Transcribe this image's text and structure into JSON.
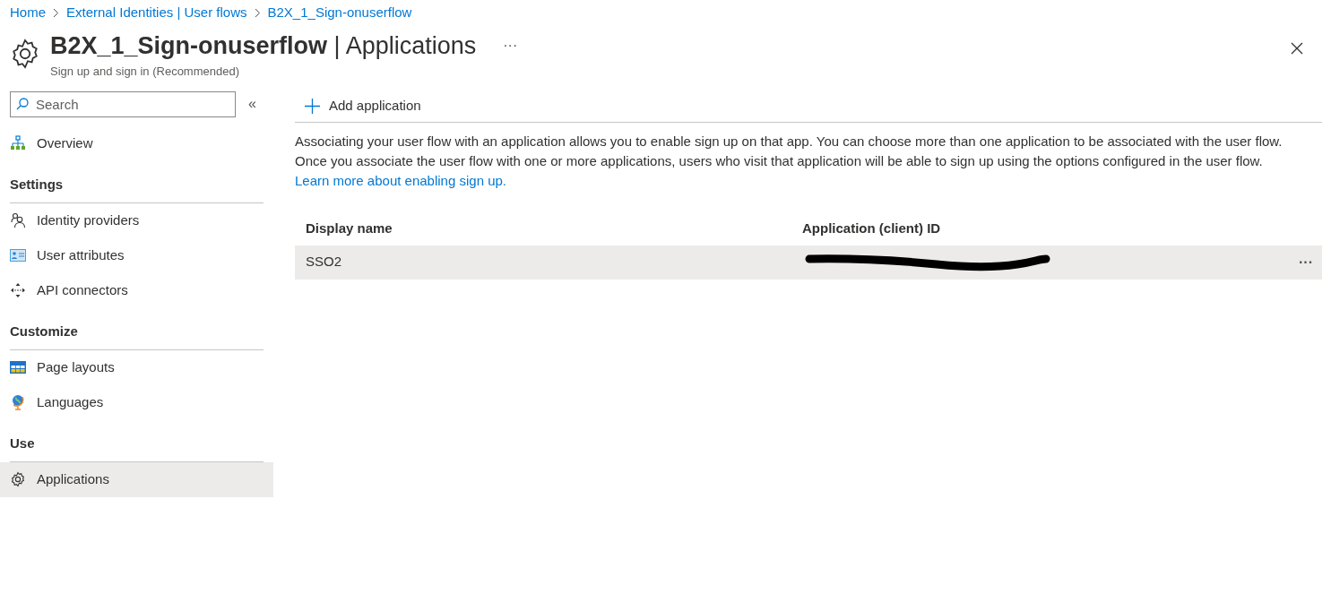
{
  "breadcrumb": [
    "Home",
    "External Identities | User flows",
    "B2X_1_Sign-onuserflow"
  ],
  "header": {
    "title": "B2X_1_Sign-onuserflow",
    "separator": "|",
    "section": "Applications",
    "subtitle": "Sign up and sign in (Recommended)",
    "more": "···"
  },
  "sidebar": {
    "search": {
      "placeholder": "Search"
    },
    "collapse": "«",
    "groups": [
      {
        "items": [
          {
            "label": "Overview",
            "selected": false
          }
        ]
      },
      {
        "heading": "Settings",
        "items": [
          {
            "label": "Identity providers",
            "selected": false
          },
          {
            "label": "User attributes",
            "selected": false
          },
          {
            "label": "API connectors",
            "selected": false
          }
        ]
      },
      {
        "heading": "Customize",
        "items": [
          {
            "label": "Page layouts",
            "selected": false
          },
          {
            "label": "Languages",
            "selected": false
          }
        ]
      },
      {
        "heading": "Use",
        "items": [
          {
            "label": "Applications",
            "selected": true
          }
        ]
      }
    ]
  },
  "toolbar": {
    "add_button": "Add application"
  },
  "description": {
    "text": "Associating your user flow with an application allows you to enable sign up on that app. You can choose more than one application to be associated with the user flow. Once you associate the user flow with one or more applications, users who visit that application will be able to sign up using the options configured in the user flow.",
    "link": "Learn more about enabling sign up."
  },
  "table": {
    "columns": [
      "Display name",
      "Application (client) ID"
    ],
    "rows": [
      {
        "name": "SSO2",
        "id_redacted": true,
        "more": "···"
      }
    ]
  }
}
